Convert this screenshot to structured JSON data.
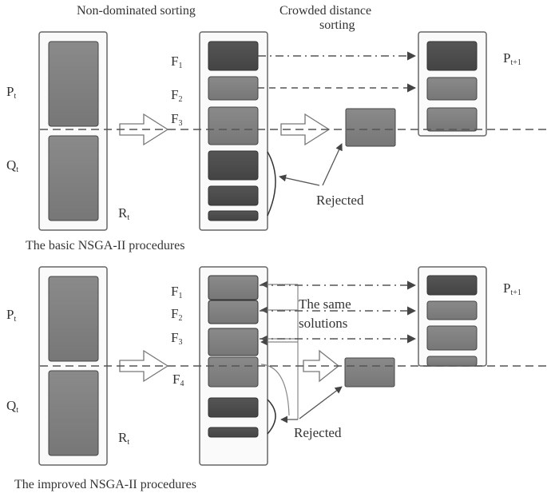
{
  "top": {
    "header_nds": "Non-dominated sorting",
    "header_cds_line1": "Crowded distance",
    "header_cds_line2": "sorting",
    "pt": "P",
    "pt_sub": "t",
    "qt": "Q",
    "qt_sub": "t",
    "rt": "R",
    "rt_sub": "t",
    "fronts": [
      {
        "f": "F",
        "s": "1"
      },
      {
        "f": "F",
        "s": "2"
      },
      {
        "f": "F",
        "s": "3"
      }
    ],
    "pnext": "P",
    "pnext_sub": "t+1",
    "rejected": "Rejected",
    "caption": "The basic  NSGA-II procedures"
  },
  "bottom": {
    "pt": "P",
    "pt_sub": "t",
    "qt": "Q",
    "qt_sub": "t",
    "rt": "R",
    "rt_sub": "t",
    "fronts": [
      {
        "f": "F",
        "s": "1"
      },
      {
        "f": "F",
        "s": "2"
      },
      {
        "f": "F",
        "s": "3"
      },
      {
        "f": "F",
        "s": "4"
      }
    ],
    "pnext": "P",
    "pnext_sub": "t+1",
    "same_line1": "The same",
    "same_line2": "solutions",
    "rejected": "Rejected",
    "caption": "The improved  NSGA-II procedures"
  },
  "colors": {
    "dark": "#4a4a4a",
    "mid": "#7a7a7a",
    "light": "#8c8c8c",
    "line": "#555555"
  }
}
